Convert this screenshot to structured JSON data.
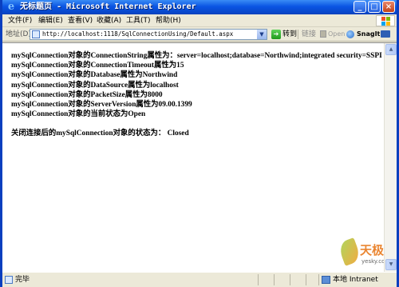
{
  "window": {
    "title": "无标题页 - Microsoft Internet Explorer",
    "minimize_glyph": "_",
    "maximize_glyph": "□",
    "close_glyph": "×"
  },
  "menubar": {
    "items": [
      "文件(F)",
      "编辑(E)",
      "查看(V)",
      "收藏(A)",
      "工具(T)",
      "帮助(H)"
    ]
  },
  "addressbar": {
    "label": "地址(D)",
    "url": "http://localhost:1118/SqlConnectionUsing/Default.aspx",
    "go_label": "转到",
    "links_label": "链接",
    "open_label": "Open",
    "snagit_label": "SnagIt"
  },
  "content": {
    "lines": [
      "mySqlConnection对象的ConnectionString属性为：server=localhost;database=Northwind;integrated security=SSPI",
      "mySqlConnection对象的ConnectionTimeout属性为15",
      "mySqlConnection对象的Database属性为Northwind",
      "mySqlConnection对象的DataSource属性为localhost",
      "mySqlConnection对象的PacketSize属性为8000",
      "mySqlConnection对象的ServerVersion属性为09.00.1399",
      "mySqlConnection对象的当前状态为Open"
    ],
    "closed_line": "关闭连接后的mySqlConnection对象的状态为： Closed"
  },
  "watermark": {
    "brand": "天极",
    "site": "yesky.com"
  },
  "statusbar": {
    "status": "完毕",
    "zone": "本地 Intranet"
  },
  "icons": {
    "ie": "ie-logo-icon",
    "page": "page-icon",
    "go": "go-arrow-icon",
    "snagit": "snagit-icon",
    "zone": "local-intranet-icon"
  }
}
